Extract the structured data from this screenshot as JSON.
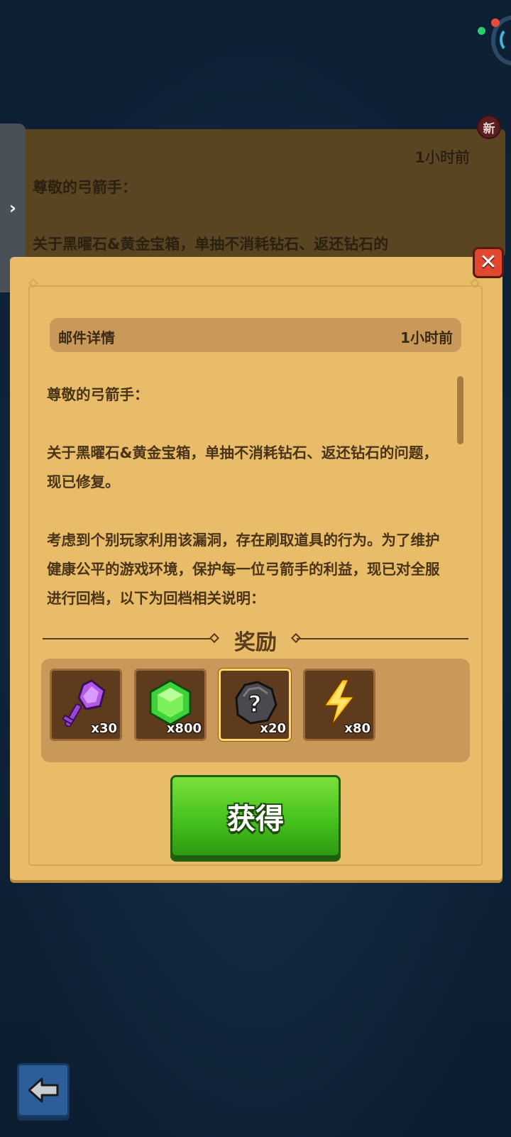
{
  "background_mail": {
    "time": "1小时前",
    "greeting": "尊敬的弓箭手：",
    "preview": "关于黑曜石&黄金宝箱，单抽不消耗钻石、返还钻石的",
    "new_badge": "新"
  },
  "modal": {
    "header_title": "邮件详情",
    "header_time": "1小时前",
    "paragraphs": [
      "尊敬的弓箭手：",
      "关于黑曜石&黄金宝箱，单抽不消耗钻石、返还钻石的问题，现已修复。",
      "考虑到个别玩家利用该漏洞，存在刷取道具的行为。为了维护健康公平的游戏环境，保护每一位弓箭手的利益，现已对全服进行回档，以下为回档相关说明："
    ],
    "rewards_title": "奖励",
    "rewards": [
      {
        "icon": "purple-key-icon",
        "count": "x30"
      },
      {
        "icon": "green-gem-icon",
        "count": "x800"
      },
      {
        "icon": "mystery-stone-icon",
        "count": "x20"
      },
      {
        "icon": "energy-bolt-icon",
        "count": "x80"
      }
    ],
    "claim_label": "获得",
    "close_label": "✕"
  },
  "side_tab_label": "›",
  "colors": {
    "modal_bg": "#e8bc69",
    "claim_green": "#46c21d",
    "close_red": "#e0472f"
  }
}
